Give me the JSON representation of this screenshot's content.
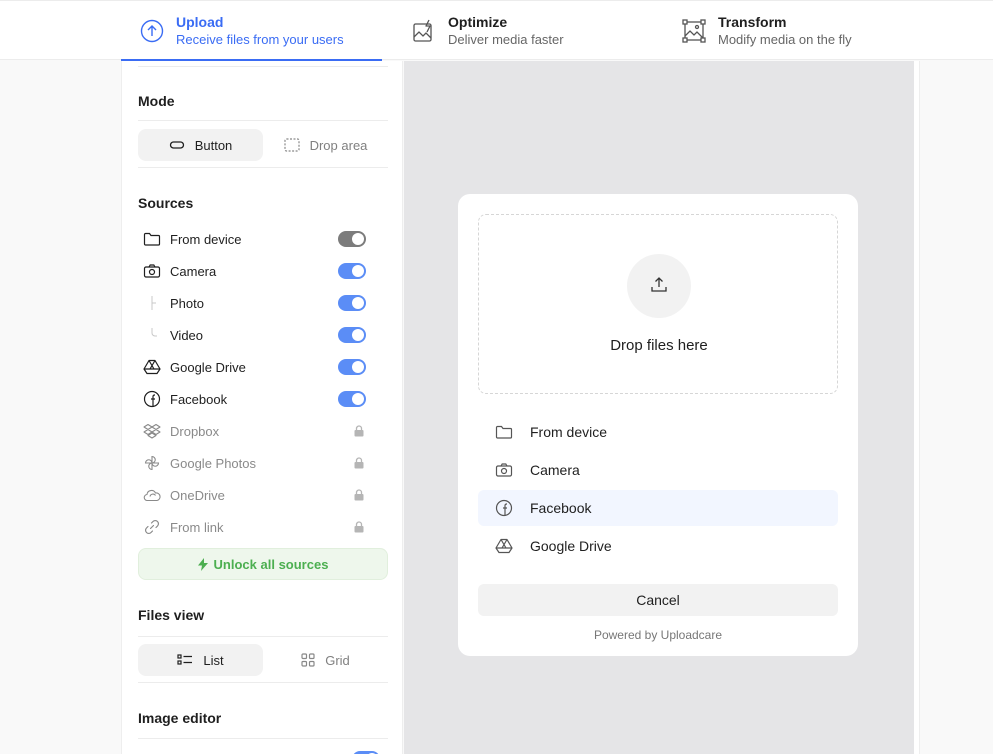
{
  "tabs": [
    {
      "title": "Upload",
      "subtitle": "Receive files from your users",
      "icon": "upload-circle-icon"
    },
    {
      "title": "Optimize",
      "subtitle": "Deliver media faster",
      "icon": "optimize-image-icon"
    },
    {
      "title": "Transform",
      "subtitle": "Modify media on the fly",
      "icon": "transform-image-icon"
    }
  ],
  "sidebar": {
    "mode": {
      "title": "Mode",
      "options": [
        "Button",
        "Drop area"
      ],
      "selected": "Button"
    },
    "sources": {
      "title": "Sources",
      "items": [
        {
          "label": "From device",
          "icon": "folder-icon",
          "state": "on-locked"
        },
        {
          "label": "Camera",
          "icon": "camera-icon",
          "state": "on"
        },
        {
          "label": "Photo",
          "icon": "tree-branch",
          "state": "on"
        },
        {
          "label": "Video",
          "icon": "tree-end",
          "state": "on"
        },
        {
          "label": "Google Drive",
          "icon": "google-drive-icon",
          "state": "on"
        },
        {
          "label": "Facebook",
          "icon": "facebook-icon",
          "state": "on"
        },
        {
          "label": "Dropbox",
          "icon": "dropbox-icon",
          "state": "locked"
        },
        {
          "label": "Google Photos",
          "icon": "google-photos-icon",
          "state": "locked"
        },
        {
          "label": "OneDrive",
          "icon": "onedrive-icon",
          "state": "locked"
        },
        {
          "label": "From link",
          "icon": "link-icon",
          "state": "locked"
        }
      ],
      "unlock_label": "Unlock all sources"
    },
    "files_view": {
      "title": "Files view",
      "options": [
        "List",
        "Grid"
      ],
      "selected": "List"
    },
    "image_editor": {
      "title": "Image editor"
    }
  },
  "widget": {
    "drop_text": "Drop files here",
    "items": [
      "From device",
      "Camera",
      "Facebook",
      "Google Drive"
    ],
    "highlighted": "Facebook",
    "cancel_label": "Cancel",
    "powered": "Powered by Uploadcare"
  },
  "colors": {
    "accent": "#3a6cf4",
    "toggle_on": "#5b8df6",
    "unlock_green": "#4caf50"
  }
}
